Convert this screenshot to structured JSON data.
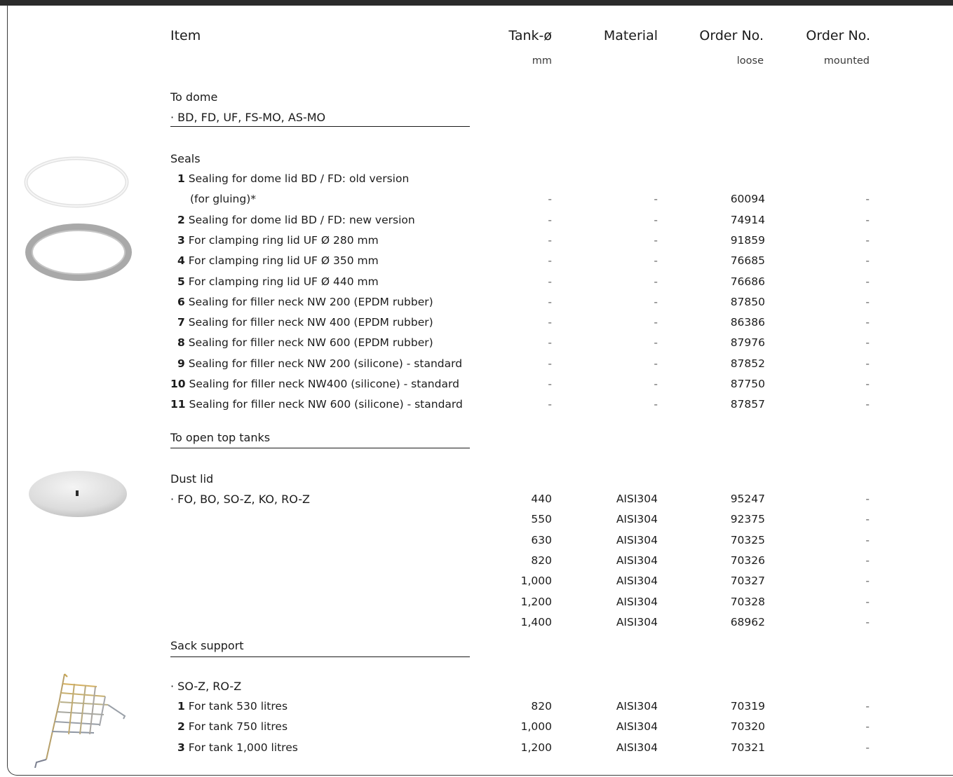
{
  "header": {
    "item": "Item",
    "tank": "Tank-ø",
    "tank_unit": "mm",
    "material": "Material",
    "order_loose": "Order No.",
    "order_loose_sub": "loose",
    "order_mounted": "Order No.",
    "order_mounted_sub": "mounted"
  },
  "dome": {
    "title": "To dome",
    "types": "· BD, FD, UF, FS-MO, AS-MO",
    "seals_label": "Seals",
    "rows": [
      {
        "n": "1",
        "desc": "Sealing for dome lid BD / FD: old version",
        "desc2": "(for gluing)*",
        "tank": "-",
        "material": "-",
        "loose": "60094",
        "mounted": "-"
      },
      {
        "n": "2",
        "desc": "Sealing for dome lid BD / FD: new version",
        "tank": "-",
        "material": "-",
        "loose": "74914",
        "mounted": "-"
      },
      {
        "n": "3",
        "desc": "For clamping ring lid UF Ø 280 mm",
        "tank": "-",
        "material": "-",
        "loose": "91859",
        "mounted": "-"
      },
      {
        "n": "4",
        "desc": "For clamping ring lid UF Ø 350 mm",
        "tank": "-",
        "material": "-",
        "loose": "76685",
        "mounted": "-"
      },
      {
        "n": "5",
        "desc": "For clamping ring lid UF Ø 440 mm",
        "tank": "-",
        "material": "-",
        "loose": "76686",
        "mounted": "-"
      },
      {
        "n": "6",
        "desc": "Sealing for filler neck NW 200 (EPDM rubber)",
        "tank": "-",
        "material": "-",
        "loose": "87850",
        "mounted": "-"
      },
      {
        "n": "7",
        "desc": "Sealing for filler neck NW 400 (EPDM rubber)",
        "tank": "-",
        "material": "-",
        "loose": "86386",
        "mounted": "-"
      },
      {
        "n": "8",
        "desc": "Sealing for filler neck NW 600 (EPDM rubber)",
        "tank": "-",
        "material": "-",
        "loose": "87976",
        "mounted": "-"
      },
      {
        "n": "9",
        "desc": "Sealing for filler neck NW 200 (silicone) - standard",
        "tank": "-",
        "material": "-",
        "loose": "87852",
        "mounted": "-"
      },
      {
        "n": "10",
        "desc": "Sealing for filler neck NW400 (silicone) - standard",
        "tank": "-",
        "material": "-",
        "loose": "87750",
        "mounted": "-"
      },
      {
        "n": "11",
        "desc": "Sealing for filler neck NW 600 (silicone) - standard",
        "tank": "-",
        "material": "-",
        "loose": "87857",
        "mounted": "-"
      }
    ]
  },
  "open_top": {
    "title": "To open top tanks",
    "dust_label": "Dust lid",
    "types": "· FO, BO, SO-Z, KO, RO-Z",
    "rows": [
      {
        "tank": "440",
        "material": "AISI304",
        "loose": "95247",
        "mounted": "-"
      },
      {
        "tank": "550",
        "material": "AISI304",
        "loose": "92375",
        "mounted": "-"
      },
      {
        "tank": "630",
        "material": "AISI304",
        "loose": "70325",
        "mounted": "-"
      },
      {
        "tank": "820",
        "material": "AISI304",
        "loose": "70326",
        "mounted": "-"
      },
      {
        "tank": "1,000",
        "material": "AISI304",
        "loose": "70327",
        "mounted": "-"
      },
      {
        "tank": "1,200",
        "material": "AISI304",
        "loose": "70328",
        "mounted": "-"
      },
      {
        "tank": "1,400",
        "material": "AISI304",
        "loose": "68962",
        "mounted": "-"
      }
    ]
  },
  "sack": {
    "title": "Sack support",
    "types": "· SO-Z, RO-Z",
    "rows": [
      {
        "n": "1",
        "desc": "For tank   530  litres",
        "tank": "820",
        "material": "AISI304",
        "loose": "70319",
        "mounted": "-"
      },
      {
        "n": "2",
        "desc": "For tank   750  litres",
        "tank": "1,000",
        "material": "AISI304",
        "loose": "70320",
        "mounted": "-"
      },
      {
        "n": "3",
        "desc": "For tank 1,000  litres",
        "tank": "1,200",
        "material": "AISI304",
        "loose": "70321",
        "mounted": "-"
      }
    ]
  },
  "images": {
    "seal_white": "white-seal-ring",
    "seal_grey": "grey-seal-ring",
    "dust_lid": "dust-lid",
    "sack_support": "sack-support-grid"
  }
}
